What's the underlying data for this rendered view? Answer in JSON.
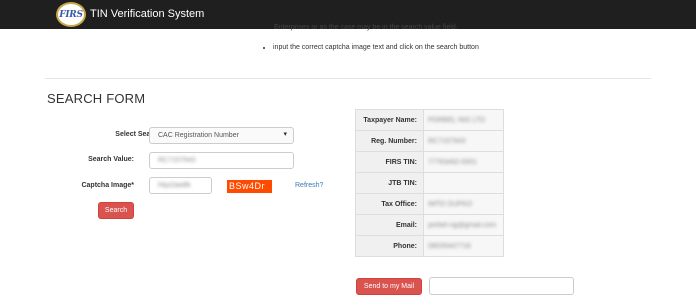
{
  "navbar": {
    "logo_text": "FIRS",
    "title": "TIN Verification System"
  },
  "instructions": {
    "continued_text": "Enterprises or as the case may be in the search value field.",
    "items": [
      "input the correct captcha image text and click on the search button"
    ]
  },
  "form": {
    "title": "SEARCH FORM",
    "criteria_label": "Select Search Criteria:",
    "criteria_value": "CAC Registration Number",
    "search_value_label": "Search Value:",
    "search_value": "RC7157943",
    "captcha_label": "Captcha Image*",
    "captcha_input_value": "Hqx2aw8k",
    "captcha_text": "BSw4Dr",
    "refresh_label": "Refresh?",
    "search_button": "Search"
  },
  "result": {
    "rows": [
      {
        "label": "Taxpayer Name:",
        "value": "PORBEL NIG LTD"
      },
      {
        "label": "Reg. Number:",
        "value": "RC7157943"
      },
      {
        "label": "FIRS TIN:",
        "value": "77763492-0001"
      },
      {
        "label": "JTB TIN:",
        "value": ""
      },
      {
        "label": "Tax Office:",
        "value": "IMTO DUPKO"
      },
      {
        "label": "Email:",
        "value": "porbel.ng@gmail.com"
      },
      {
        "label": "Phone:",
        "value": "08035447716"
      }
    ],
    "send_button": "Send to my Mail"
  }
}
